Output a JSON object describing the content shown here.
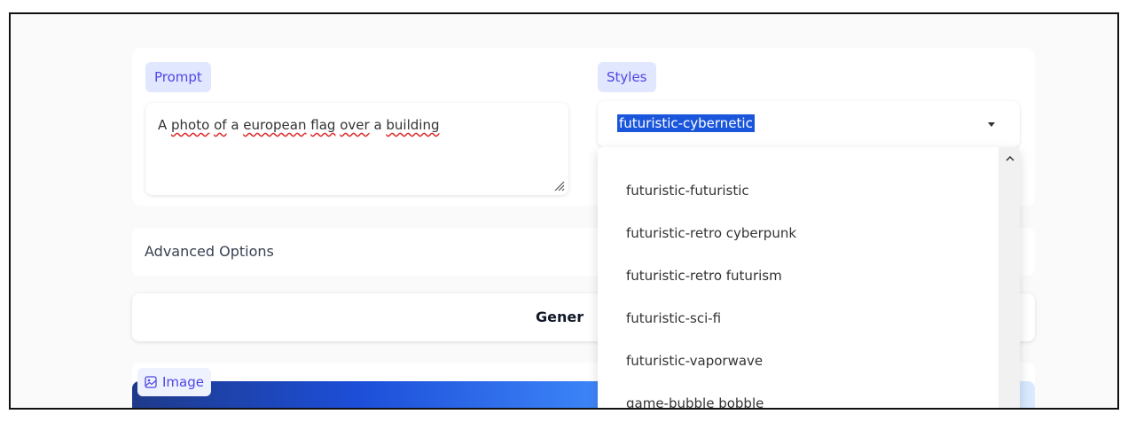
{
  "prompt": {
    "label": "Prompt",
    "words": [
      "A ",
      "photo",
      " ",
      "of",
      " a ",
      "european",
      " ",
      "flag",
      " ",
      "over",
      " a ",
      "building"
    ]
  },
  "styles": {
    "label": "Styles",
    "selected": "futuristic-cybernetic",
    "options": [
      "futuristic-futuristic",
      "futuristic-retro cyberpunk",
      "futuristic-retro futurism",
      "futuristic-sci-fi",
      "futuristic-vaporwave",
      "game-bubble bobble"
    ]
  },
  "advanced": {
    "label": "Advanced Options"
  },
  "generate": {
    "label": "Gener"
  },
  "image": {
    "label": "Image"
  },
  "colors": {
    "accent": "#4f46e5",
    "chip_bg": "#e0e7ff",
    "selection": "#1a56db"
  }
}
